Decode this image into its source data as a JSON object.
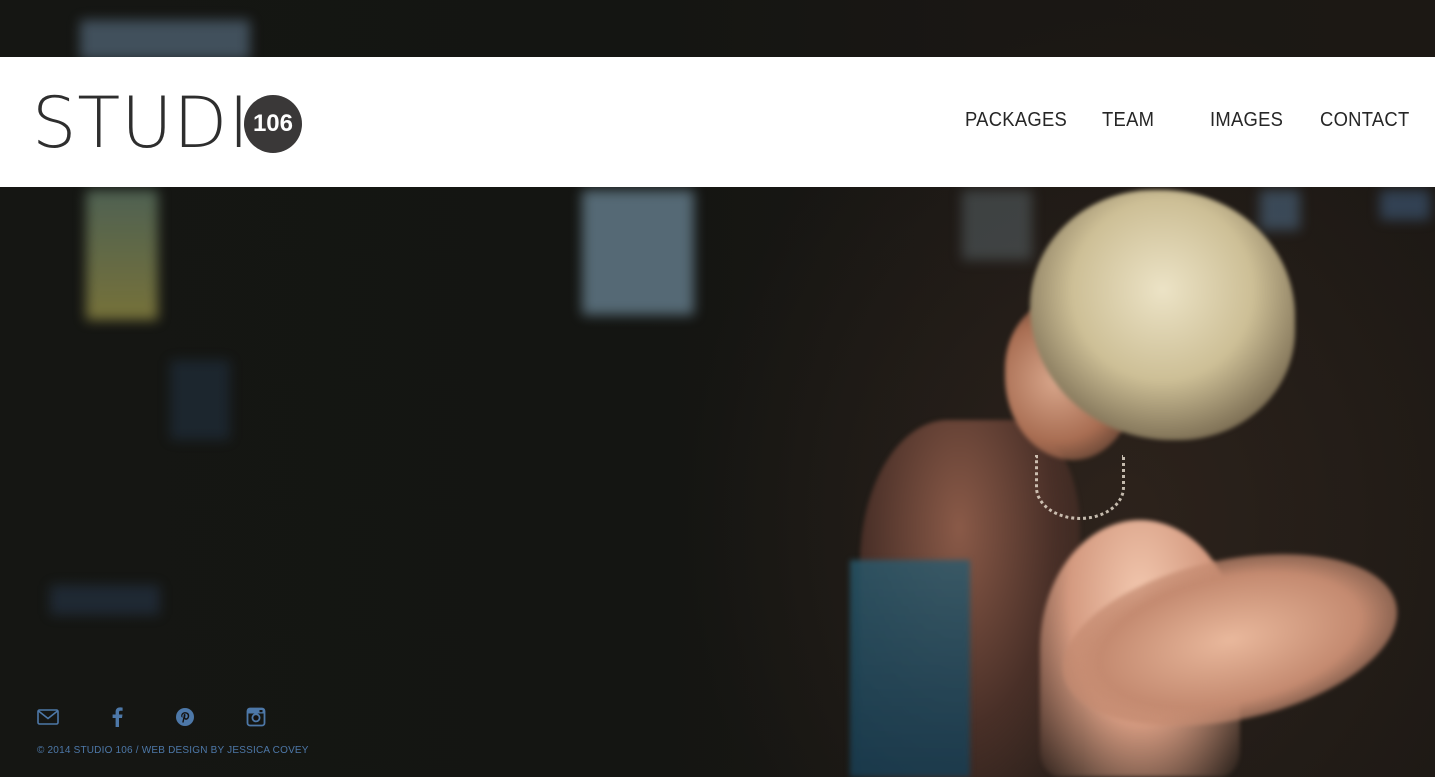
{
  "brand": {
    "wordmark": "STUDI",
    "badge": "106"
  },
  "nav": {
    "items": [
      {
        "label": "PACKAGES"
      },
      {
        "label": "TEAM"
      },
      {
        "label": "IMAGES"
      },
      {
        "label": "CONTACT"
      }
    ]
  },
  "footer": {
    "social": [
      {
        "icon": "email-icon"
      },
      {
        "icon": "facebook-icon"
      },
      {
        "icon": "pinterest-icon"
      },
      {
        "icon": "instagram-icon"
      }
    ],
    "copyright": "© 2014 STUDIO 106 / WEB DESIGN BY JESSICA COVEY"
  },
  "colors": {
    "header_bg": "#ffffff",
    "nav_text": "#262626",
    "badge_bg": "#3a3838",
    "footer_accent": "#4d78a8"
  }
}
